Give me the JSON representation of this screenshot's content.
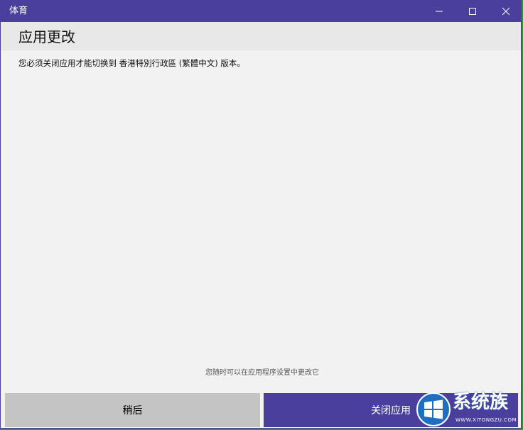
{
  "window": {
    "title": "体育",
    "accent_color": "#4b3f9e"
  },
  "controls": {
    "minimize_icon": "minimize-icon",
    "maximize_icon": "maximize-icon",
    "close_icon": "close-icon"
  },
  "dialog": {
    "title": "应用更改",
    "message": "您必须关闭应用才能切换到 香港特別行政區 (繁體中文) 版本。",
    "hint": "您随时可以在应用程序设置中更改它"
  },
  "buttons": {
    "later_label": "稍后",
    "close_app_label": "关闭应用"
  },
  "watermark": {
    "text": "系统族",
    "subtext": "WWW.XITONGZU.COM",
    "logo_icon": "windows-logo-icon"
  }
}
